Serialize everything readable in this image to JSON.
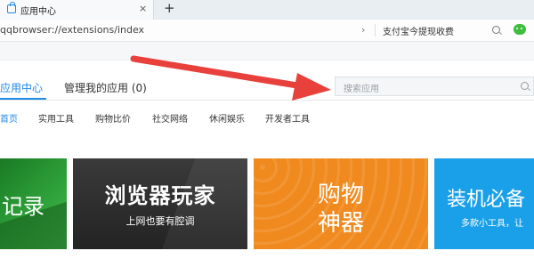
{
  "tab": {
    "title": "应用中心",
    "close": "×",
    "new_tab": "+"
  },
  "address": {
    "url": "qqbrowser://extensions/index",
    "arrow": "›",
    "hint": "支付宝今提现收费"
  },
  "header": {
    "main_tab_active": "应用中心",
    "main_tab_manage": "管理我的应用 (0)",
    "search_placeholder": "搜索应用"
  },
  "categories": [
    "首页",
    "实用工具",
    "购物比价",
    "社交网络",
    "休闲娱乐",
    "开发者工具"
  ],
  "banners": {
    "b1_text": "记录",
    "b2_title": "浏览器玩家",
    "b2_sub": "上网也要有腔调",
    "b3_line1": "购物",
    "b3_line2": "神器",
    "b4_title": "装机必备",
    "b4_sub": "多款小工具，让"
  },
  "colors": {
    "accent": "#1f8ae8",
    "arrow": "#e8413c"
  }
}
